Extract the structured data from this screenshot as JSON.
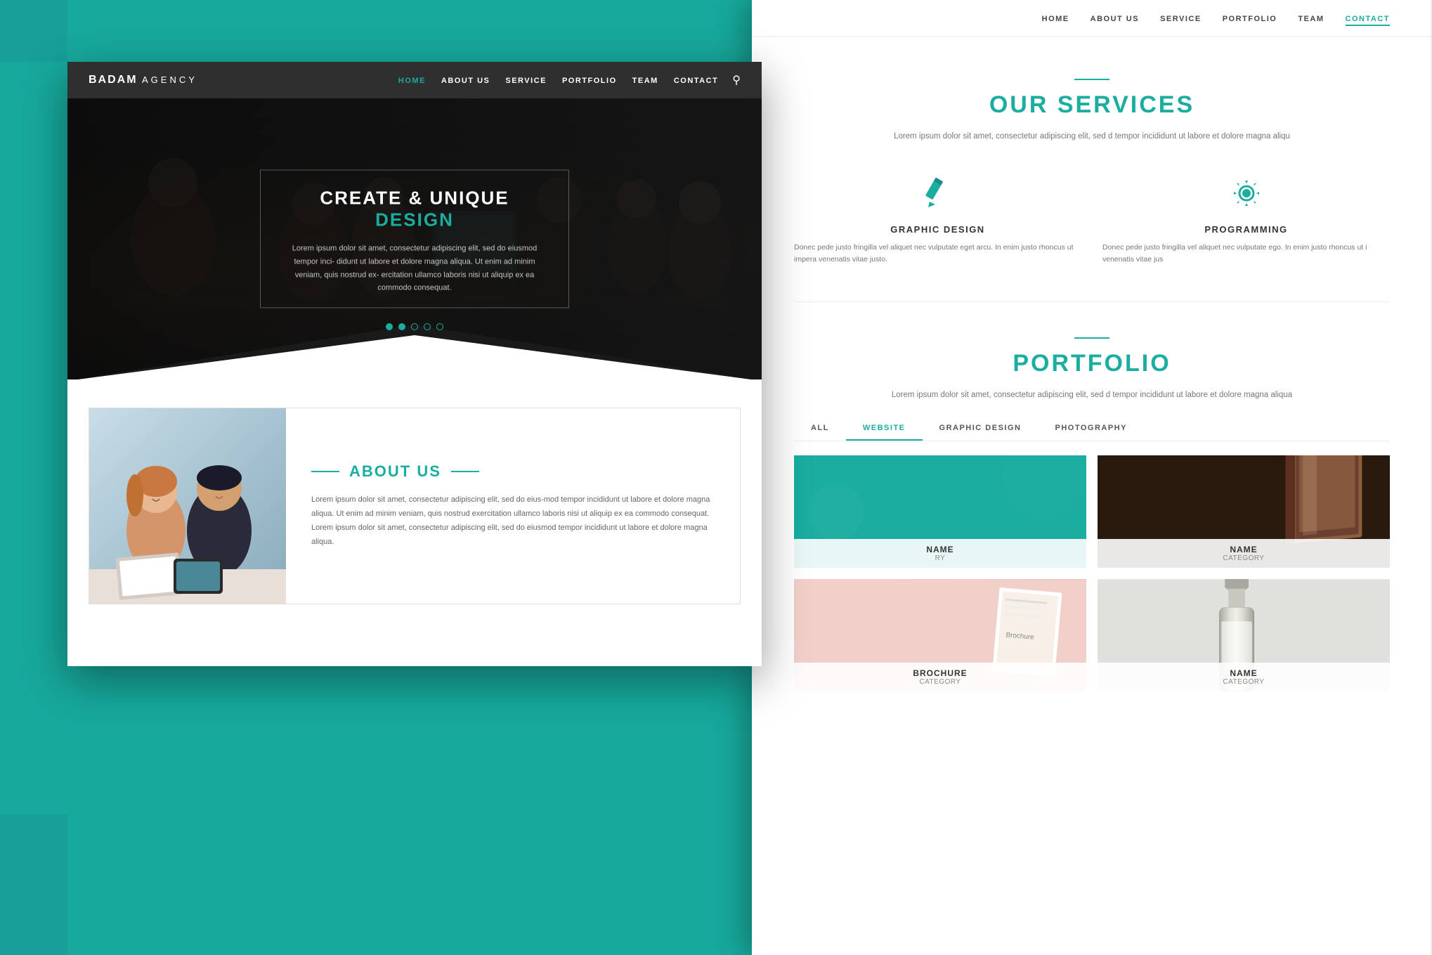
{
  "brand": {
    "name_bold": "BADAM",
    "name_light": " AGENCY"
  },
  "navbar": {
    "home": "HOME",
    "about": "ABOUT US",
    "service": "SERVICE",
    "portfolio": "PORTFOLIO",
    "team": "TEAM",
    "contact": "CONTACT"
  },
  "hero": {
    "title_white": "CREATE & UNIQUE ",
    "title_teal": "DESIGN",
    "description": "Lorem ipsum dolor sit amet, consectetur adipiscing elit, sed do eiusmod tempor inci-\ndidunt ut labore et dolore magna aliqua. Ut enim ad minim veniam, quis nostrud ex-\nercitation ullamco laboris nisi ut aliquip ex ea commodo consequat.",
    "dots": [
      1,
      2,
      3,
      4,
      5
    ],
    "active_dot": 2
  },
  "about": {
    "title": "ABOUT US",
    "description": "Lorem ipsum dolor sit amet, consectetur adipiscing elit, sed do eius-mod tempor incididunt ut labore et dolore magna aliqua. Ut enim ad minim veniam, quis nostrud exercitation ullamco laboris nisi ut aliquip ex ea commodo consequat. Lorem ipsum dolor sit amet, consectetur adipiscing elit, sed do eiusmod tempor incididunt ut labore et dolore magna aliqua."
  },
  "services": {
    "title": "OUR SERVICES",
    "description": "Lorem ipsum dolor sit amet, consectetur adipiscing elit, sed d tempor incididunt ut labore et dolore magna aliqu",
    "items": [
      {
        "icon": "pencil",
        "title": "GRAPHIC DESIGN",
        "description": "Donec pede justo fringilla vel aliquet nec vulputate eget arcu. In enim justo rhoncus ut impera venenatis vitae justo."
      },
      {
        "icon": "gear",
        "title": "PROGRAMMING",
        "description": "Donec pede justo fringilla vel aliquet nec vulputate ego. In enim justo rhoncus ut i venenatis vitae jus"
      }
    ]
  },
  "portfolio": {
    "title": "PORTFOLIO",
    "description": "Lorem ipsum dolor sit amet, consectetur adipiscing elit, sed d tempor incididunt ut labore et dolore magna aliqua",
    "tabs": [
      "ALL",
      "WEBSITE",
      "GRAPHIC DESIGN",
      "PHOTOGRAPHY"
    ],
    "active_tab": 1,
    "items": [
      {
        "name": "NAME",
        "category": "RY",
        "type": "teal"
      },
      {
        "name": "NAME",
        "category": "CATEGORY",
        "type": "magazine"
      },
      {
        "name": "Brochure",
        "category": "CATEGORY",
        "type": "brochure"
      },
      {
        "name": "NAME",
        "category": "CATEGORY",
        "type": "bottle"
      }
    ]
  },
  "colors": {
    "teal": "#1aada0",
    "dark": "#1a1a1a",
    "white": "#ffffff",
    "gray": "#666666"
  }
}
